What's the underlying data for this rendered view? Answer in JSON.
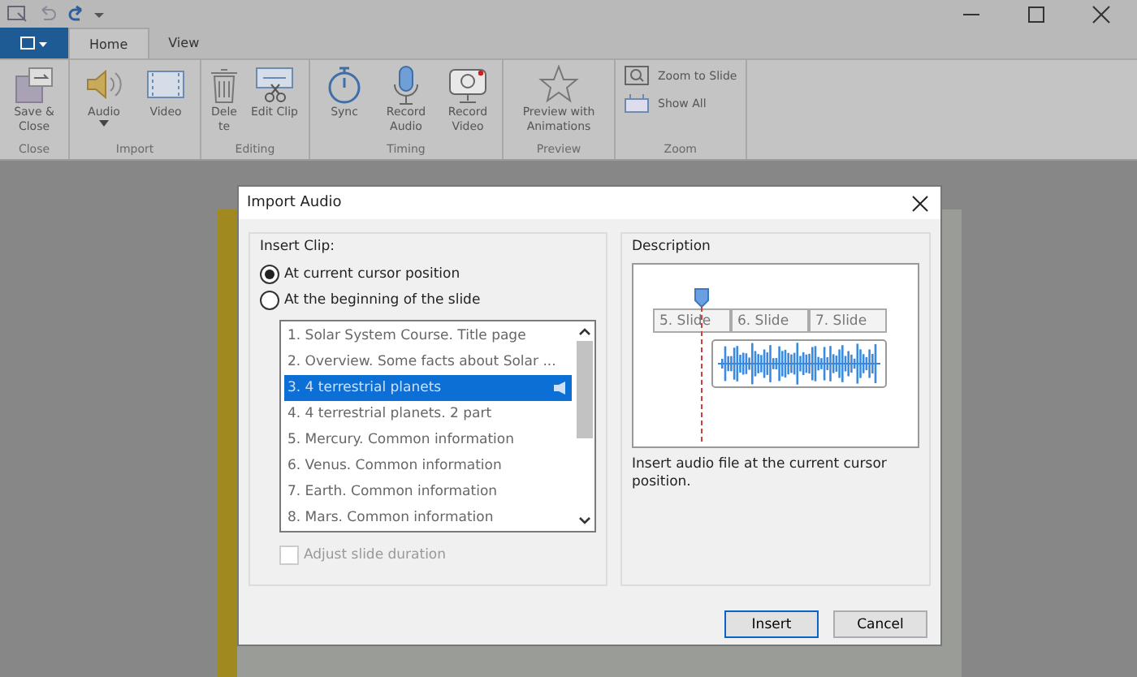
{
  "app_menu": {
    "expanded": false
  },
  "tabs": [
    {
      "label": "Home",
      "selected": true
    },
    {
      "label": "View",
      "selected": false
    }
  ],
  "ribbon_groups": [
    {
      "label": "Close",
      "buttons": [
        {
          "label": "Save & Close",
          "kind": "save",
          "dropdown": false
        }
      ]
    },
    {
      "label": "Import",
      "buttons": [
        {
          "label": "Audio",
          "kind": "audio",
          "dropdown": true
        },
        {
          "label": "Video",
          "kind": "video",
          "dropdown": false
        }
      ]
    },
    {
      "label": "Editing",
      "buttons": [
        {
          "label": "Delete",
          "kind": "delete",
          "dropdown": false
        },
        {
          "label": "Edit Clip",
          "kind": "editclip",
          "dropdown": false
        }
      ]
    },
    {
      "label": "Timing",
      "buttons": [
        {
          "label": "Sync",
          "kind": "sync",
          "dropdown": false
        },
        {
          "label": "Record Audio",
          "kind": "mic",
          "dropdown": false
        },
        {
          "label": "Record Video",
          "kind": "camera",
          "dropdown": false
        }
      ]
    },
    {
      "label": "Preview",
      "buttons": [
        {
          "label": "Preview with Animations",
          "kind": "star",
          "dropdown": false
        }
      ]
    },
    {
      "label": "Zoom",
      "small_buttons": [
        {
          "label": "Zoom to Slide",
          "kind": "zoom"
        },
        {
          "label": "Show All",
          "kind": "showall"
        }
      ]
    }
  ],
  "dialog": {
    "title": "Import Audio",
    "insert_clip": {
      "label": "Insert Clip:",
      "options": [
        {
          "label": "At current cursor position",
          "selected": true
        },
        {
          "label": "At the beginning of the slide",
          "selected": false
        }
      ],
      "slides": [
        {
          "label": "1. Solar System Course. Title page",
          "selected": false,
          "audio": false
        },
        {
          "label": "2. Overview. Some facts about Solar ...",
          "selected": false,
          "audio": false
        },
        {
          "label": "3. 4 terrestrial planets",
          "selected": true,
          "audio": true
        },
        {
          "label": "4. 4 terrestrial planets. 2 part",
          "selected": false,
          "audio": false
        },
        {
          "label": "5. Mercury. Common information",
          "selected": false,
          "audio": false
        },
        {
          "label": "6. Venus. Common information",
          "selected": false,
          "audio": false
        },
        {
          "label": "7. Earth. Common information",
          "selected": false,
          "audio": false
        },
        {
          "label": "8. Mars. Common information",
          "selected": false,
          "audio": false
        }
      ],
      "adjust": {
        "label": "Adjust slide duration",
        "checked": false,
        "disabled": true
      }
    },
    "description": {
      "label": "Description",
      "slides": [
        "5. Slide",
        "6. Slide",
        "7. Slide"
      ],
      "text": "Insert audio file at the current cursor position."
    },
    "buttons": [
      {
        "label": "Insert",
        "default": true
      },
      {
        "label": "Cancel",
        "default": false
      }
    ]
  }
}
